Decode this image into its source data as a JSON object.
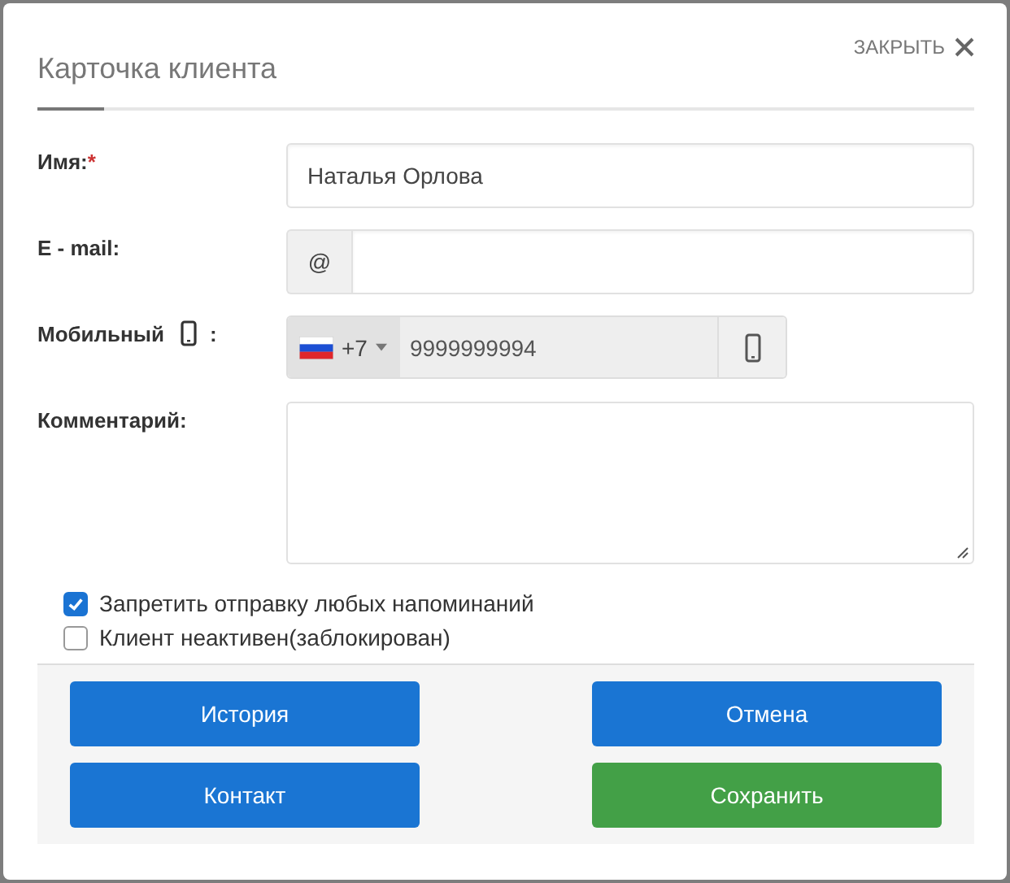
{
  "dialog": {
    "title": "Карточка клиента",
    "close_label": "ЗАКРЫТЬ"
  },
  "fields": [
    {
      "kind": "text",
      "label": "Имя:",
      "required_mark": "*",
      "value": "Наталья Орлова"
    },
    {
      "kind": "email",
      "label": "E - mail:",
      "prefix": "@"
    },
    {
      "kind": "phone",
      "label": "Мобильный",
      "label_suffix": ":",
      "country_code": "+7",
      "value": "9999999994"
    },
    {
      "kind": "textarea",
      "label": "Комментарий:"
    }
  ],
  "checkboxes": [
    {
      "label": "Запретить отправку любых напоминаний",
      "checked": true
    },
    {
      "label": "Клиент неактивен(заблокирован)",
      "checked": false
    }
  ],
  "buttons": [
    {
      "label": "История",
      "kind": "primary"
    },
    {
      "label": "Отмена",
      "kind": "primary"
    },
    {
      "label": "Контакт",
      "kind": "primary"
    },
    {
      "label": "Сохранить",
      "kind": "success"
    }
  ]
}
